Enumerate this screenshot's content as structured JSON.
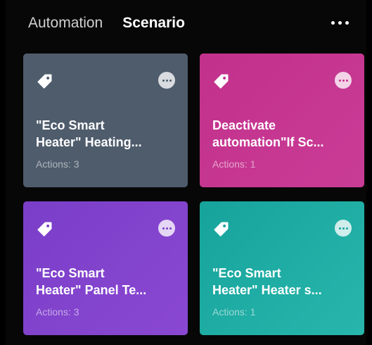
{
  "header": {
    "tab_automation": "Automation",
    "tab_scenario": "Scenario",
    "more_icon": "more-horizontal-icon"
  },
  "cards": [
    {
      "title_line1": "\"Eco Smart",
      "title_line2": "Heater\" Heating...",
      "actions": "Actions: 3",
      "color": "#4e5c6c",
      "icon": "tag-icon"
    },
    {
      "title_line1": "Deactivate",
      "title_line2": "automation\"If Sc...",
      "actions": "Actions: 1",
      "color": "#c2318c",
      "icon": "tag-icon"
    },
    {
      "title_line1": "\"Eco Smart",
      "title_line2": "Heater\" Panel Te...",
      "actions": "Actions: 3",
      "color": "#7a3ec8",
      "icon": "tag-icon"
    },
    {
      "title_line1": "\"Eco Smart",
      "title_line2": "Heater\" Heater s...",
      "actions": "Actions: 1",
      "color": "#16a39c",
      "icon": "tag-icon"
    }
  ]
}
